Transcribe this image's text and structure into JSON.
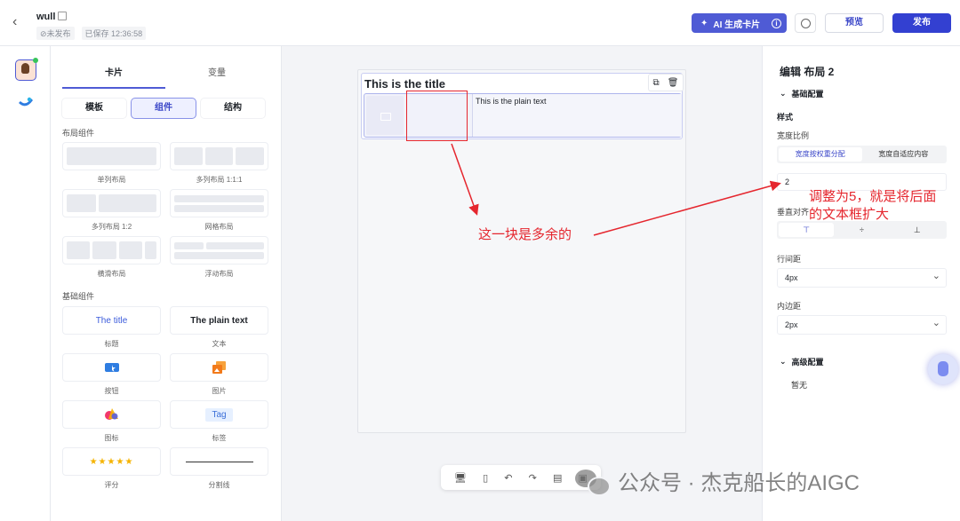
{
  "header": {
    "app_name": "wull",
    "status_unpublished": "⊘未发布",
    "status_saved": "已保存 12:36:58",
    "ai_button": "AI 生成卡片",
    "preview": "预览",
    "publish": "发布"
  },
  "panel": {
    "tabs": [
      "卡片",
      "变量"
    ],
    "segments": [
      "模板",
      "组件",
      "结构"
    ],
    "layout_section": "布局组件",
    "layout_items": [
      "单列布局",
      "多列布局 1:1:1",
      "多列布局 1:2",
      "网格布局",
      "横滑布局",
      "浮动布局"
    ],
    "basic_section": "基础组件",
    "basic_items": {
      "title_preview": "The title",
      "title_label": "标题",
      "text_preview": "The plain text",
      "text_label": "文本",
      "button_label": "按钮",
      "image_label": "图片",
      "icon_label": "图标",
      "tag_preview": "Tag",
      "tag_label": "标签",
      "rating_preview": "★★★★★",
      "rating_label": "评分",
      "divider_label": "分割线"
    }
  },
  "canvas": {
    "card_title": "This is the title",
    "plain_text": "This is the plain text"
  },
  "props": {
    "title": "编辑 布局 2",
    "basic_config": "基础配置",
    "style_label": "样式",
    "width_ratio_label": "宽度比例",
    "width_options": [
      "宽度按权重分配",
      "宽度自适应内容"
    ],
    "ratio_value": "2",
    "vertical_align_label": "垂直对齐",
    "line_spacing_label": "行间距",
    "line_spacing_value": "4px",
    "padding_label": "内边距",
    "padding_value": "2px",
    "advanced_config": "高级配置",
    "advanced_none": "暂无"
  },
  "annotations": {
    "redundant": "这一块是多余的",
    "adjust_line1": "调整为5，就是将后面",
    "adjust_line2": "的文本框扩大"
  },
  "watermark": {
    "text": "公众号 · 杰克船长的AIGC"
  },
  "colors": {
    "accent": "#4f5bd5",
    "annotation": "#e5262e"
  }
}
